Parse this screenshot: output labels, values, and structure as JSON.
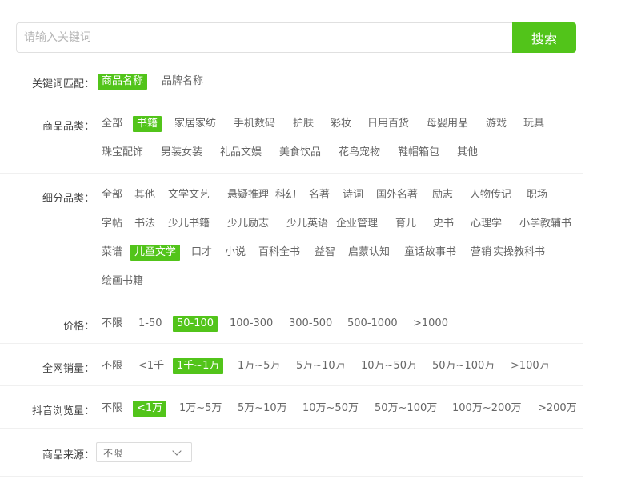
{
  "top_link": "",
  "search": {
    "placeholder": "请输入关键词",
    "button": "搜索"
  },
  "keyword_match": {
    "label": "关键词匹配：",
    "options": [
      "商品名称",
      "品牌名称"
    ],
    "selected": 0
  },
  "category": {
    "label": "商品品类：",
    "options": [
      "全部",
      "书籍",
      "家居家纺",
      "手机数码",
      "护肤",
      "彩妆",
      "日用百货",
      "母婴用品",
      "游戏",
      "玩具",
      "珠宝配饰",
      "男装女装",
      "礼品文娱",
      "美食饮品",
      "花鸟宠物",
      "鞋帽箱包",
      "其他"
    ],
    "selected": 1
  },
  "subcategory": {
    "label": "细分品类：",
    "options": [
      "全部",
      "其他",
      "文学文艺",
      "悬疑推理",
      "科幻",
      "名著",
      "诗词",
      "国外名著",
      "励志",
      "人物传记",
      "职场",
      "字帖",
      "书法",
      "少儿书籍",
      "少儿励志",
      "少儿英语",
      "企业管理",
      "育儿",
      "史书",
      "心理学",
      "小学教辅书",
      "菜谱",
      "儿童文学",
      "口才",
      "小说",
      "百科全书",
      "益智",
      "启蒙认知",
      "童话故事书",
      "营销",
      "实操教科书",
      "绘画书籍"
    ],
    "selected": 22
  },
  "price": {
    "label": "价格：",
    "options": [
      "不限",
      "1-50",
      "50-100",
      "100-300",
      "300-500",
      "500-1000",
      ">1000"
    ],
    "selected": 2
  },
  "sales": {
    "label": "全网销量：",
    "options": [
      "不限",
      "<1千",
      "1千~1万",
      "1万~5万",
      "5万~10万",
      "10万~50万",
      "50万~100万",
      ">100万"
    ],
    "selected": 2
  },
  "views": {
    "label": "抖音浏览量：",
    "options": [
      "不限",
      "<1万",
      "1万~5万",
      "5万~10万",
      "10万~50万",
      "50万~100万",
      "100万~200万",
      ">200万"
    ],
    "selected": 1
  },
  "source": {
    "label": "商品来源：",
    "value": "不限"
  }
}
